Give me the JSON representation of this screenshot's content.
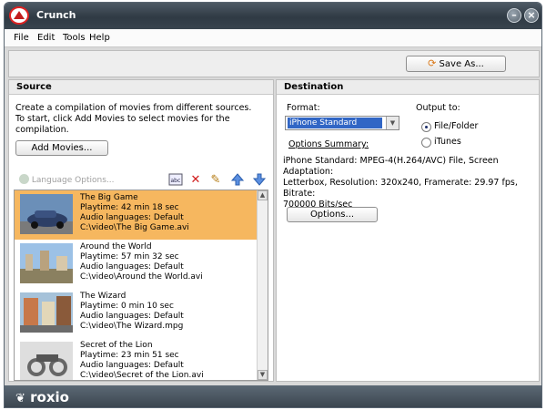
{
  "window": {
    "title": "Crunch"
  },
  "menu": [
    "File",
    "Edit",
    "Tools",
    "Help"
  ],
  "toolbar": {
    "save_as_label": "Save As..."
  },
  "source": {
    "header": "Source",
    "instructions": [
      "Create a compilation of movies from different sources.",
      "To start, click Add Movies to select movies for the",
      "compilation."
    ],
    "add_movies_label": "Add Movies...",
    "language_options_label": "Language Options...",
    "items": [
      {
        "title": "The Big Game",
        "playtime": "Playtime: 42 min 18 sec",
        "audio": "Audio languages: Default",
        "path": "C:\\video\\The Big Game.avi",
        "selected": true
      },
      {
        "title": "Around the World",
        "playtime": "Playtime: 57 min 32 sec",
        "audio": "Audio languages: Default",
        "path": "C:\\video\\Around the World.avi",
        "selected": false
      },
      {
        "title": "The Wizard",
        "playtime": "Playtime: 0 min 10 sec",
        "audio": "Audio languages: Default",
        "path": "C:\\video\\The Wizard.mpg",
        "selected": false
      },
      {
        "title": "Secret of the Lion",
        "playtime": "Playtime: 23 min 51 sec",
        "audio": "Audio languages: Default",
        "path": "C:\\video\\Secret of the Lion.avi",
        "selected": false
      }
    ]
  },
  "destination": {
    "header": "Destination",
    "format_label": "Format:",
    "format_value": "iPhone Standard",
    "output_to_label": "Output to:",
    "output_options": [
      {
        "label": "File/Folder",
        "selected": true
      },
      {
        "label": "iTunes",
        "selected": false
      }
    ],
    "options_summary_label": "Options Summary:",
    "summary_lines": [
      "iPhone Standard: MPEG-4(H.264/AVC)  File, Screen Adaptation:",
      "Letterbox, Resolution: 320x240, Framerate: 29.97 fps, Bitrate:",
      "700000 Bits/sec"
    ],
    "options_button_label": "Options..."
  },
  "footer": {
    "brand": "roxio"
  },
  "colors": {
    "selected_row": "#f6b75f",
    "titlebar": "#2f3a44",
    "select_highlight": "#3166c5"
  }
}
